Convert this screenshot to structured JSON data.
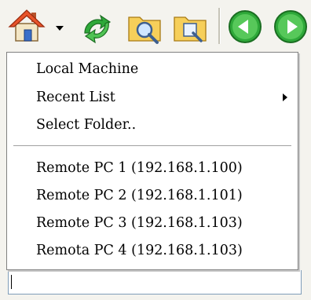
{
  "toolbar": {
    "buttons": [
      {
        "name": "home-button",
        "icon": "home-icon"
      },
      {
        "name": "dropdown-button",
        "icon": "chevron-down-icon"
      },
      {
        "name": "refresh-button",
        "icon": "refresh-icon"
      },
      {
        "name": "folder-search-button",
        "icon": "folder-search-icon"
      },
      {
        "name": "folder-favorite-button",
        "icon": "folder-favorite-icon"
      },
      {
        "name": "back-button",
        "icon": "back-arrow-icon"
      },
      {
        "name": "forward-button",
        "icon": "forward-arrow-icon"
      }
    ]
  },
  "menu": {
    "items": [
      {
        "label": "Local Machine"
      },
      {
        "label": "Recent List",
        "submenu": true
      },
      {
        "label": "Select Folder.."
      },
      {
        "label": "Remote PC 1 (192.168.1.100)"
      },
      {
        "label": "Remote PC 2 (192.168.1.101)"
      },
      {
        "label": "Remote PC 3 (192.168.1.103)"
      },
      {
        "label": "Remota PC 4 (192.168.1.103)"
      }
    ]
  },
  "colors": {
    "toolbar_bg": "#f4f3ee",
    "menu_bg": "#ffffff",
    "green_accent": "#2fa93a",
    "home_roof": "#e8542a",
    "home_wall": "#3a6fc9"
  }
}
